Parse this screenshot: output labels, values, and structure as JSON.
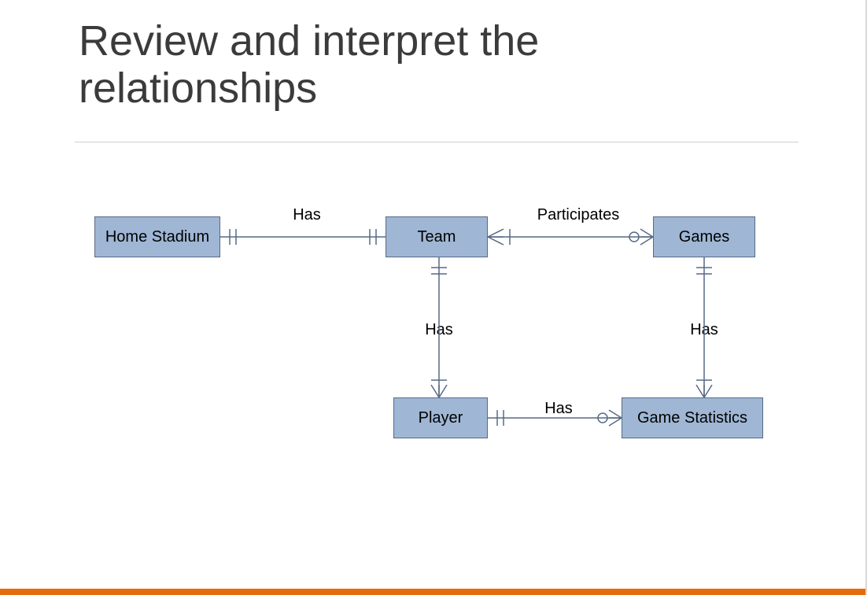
{
  "title": "Review and interpret the relationships",
  "entities": {
    "home_stadium": "Home Stadium",
    "team": "Team",
    "games": "Games",
    "player": "Player",
    "game_statistics": "Game Statistics"
  },
  "relationships": {
    "stadium_team": "Has",
    "team_games": "Participates",
    "team_player": "Has",
    "games_stats": "Has",
    "player_stats": "Has"
  },
  "diagram_spec": {
    "note": "Entity-Relationship diagram (crow's foot notation).",
    "entities": [
      "Home Stadium",
      "Team",
      "Games",
      "Player",
      "Game Statistics"
    ],
    "relationships": [
      {
        "from": "Home Stadium",
        "to": "Team",
        "label": "Has",
        "from_card": "one-and-only-one",
        "to_card": "one-and-only-one"
      },
      {
        "from": "Team",
        "to": "Games",
        "label": "Participates",
        "from_card": "one-or-more",
        "to_card": "zero-or-more"
      },
      {
        "from": "Team",
        "to": "Player",
        "label": "Has",
        "from_card": "one-and-only-one",
        "to_card": "one-or-more"
      },
      {
        "from": "Games",
        "to": "Game Statistics",
        "label": "Has",
        "from_card": "one-and-only-one",
        "to_card": "one-or-more"
      },
      {
        "from": "Player",
        "to": "Game Statistics",
        "label": "Has",
        "from_card": "one-and-only-one",
        "to_card": "zero-or-more"
      }
    ]
  }
}
